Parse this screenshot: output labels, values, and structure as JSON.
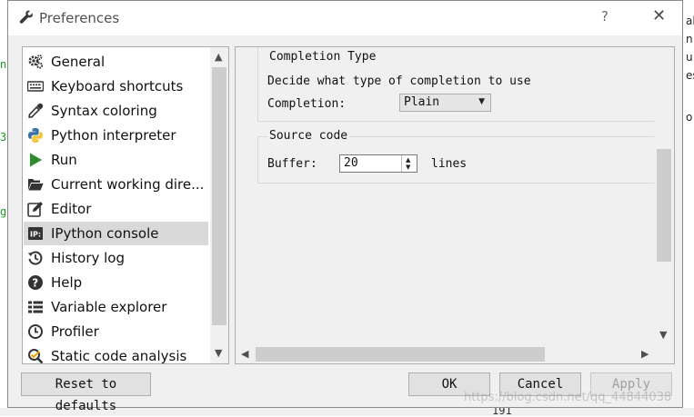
{
  "background_app": {
    "left_glyphs": [
      "ns",
      "3",
      "g"
    ],
    "right_glyphs": [
      "al",
      "n",
      "u",
      "es",
      "o"
    ],
    "bottom_number": "191"
  },
  "dialog": {
    "title": "Preferences",
    "help_glyph": "?",
    "close_glyph": "✕"
  },
  "nav": {
    "items": [
      {
        "label": "General",
        "icon": "gears-icon"
      },
      {
        "label": "Keyboard shortcuts",
        "icon": "keyboard-icon"
      },
      {
        "label": "Syntax coloring",
        "icon": "eyedropper-icon"
      },
      {
        "label": "Python interpreter",
        "icon": "python-icon"
      },
      {
        "label": "Run",
        "icon": "play-icon"
      },
      {
        "label": "Current working dire...",
        "icon": "folder-open-icon"
      },
      {
        "label": "Editor",
        "icon": "edit-icon"
      },
      {
        "label": "IPython console",
        "icon": "ipython-icon",
        "selected": true
      },
      {
        "label": "History log",
        "icon": "history-icon"
      },
      {
        "label": "Help",
        "icon": "question-circle-icon"
      },
      {
        "label": "Variable explorer",
        "icon": "table-list-icon"
      },
      {
        "label": "Profiler",
        "icon": "clock-icon"
      },
      {
        "label": "Static code analysis",
        "icon": "magnifier-check-icon"
      }
    ]
  },
  "panel": {
    "completion_group": {
      "title": "Completion Type",
      "description": "Decide what type of completion to use",
      "label": "Completion:",
      "value": "Plain"
    },
    "source_group": {
      "title": "Source code",
      "label": "Buffer:",
      "value": "20",
      "suffix": "lines"
    }
  },
  "buttons": {
    "reset": "Reset to defaults",
    "ok": "OK",
    "cancel": "Cancel",
    "apply": "Apply"
  },
  "watermark": "https://blog.csdn.net/qq_44844038",
  "colors": {
    "selection": "#d9d9d9",
    "run_green": "#2e8b2e",
    "python_blue": "#3572a5",
    "python_yellow": "#f3c737"
  }
}
